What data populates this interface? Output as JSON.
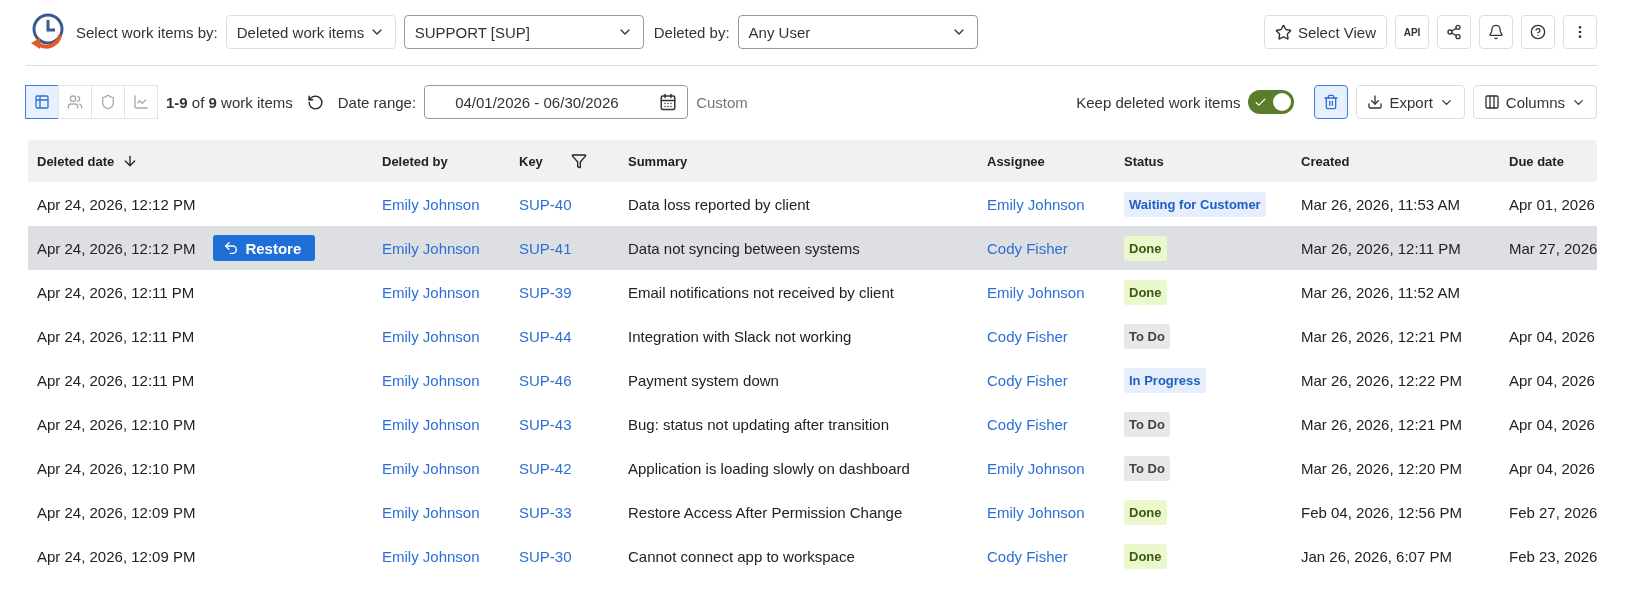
{
  "filter_bar": {
    "select_label": "Select work items by:",
    "mode": "Deleted work items",
    "project": "SUPPORT [SUP]",
    "deleted_by_label": "Deleted by:",
    "deleted_by": "Any User",
    "select_view": "Select View",
    "api": "API"
  },
  "toolbar": {
    "view_modes": [
      {
        "kind": "table",
        "selected": true
      },
      {
        "kind": "people",
        "selected": false
      },
      {
        "kind": "shield",
        "selected": false
      },
      {
        "kind": "chart",
        "selected": false
      }
    ],
    "count": "**1-9** of **9** work items",
    "date_label": "Date range:",
    "date_range": "04/01/2026 - 06/30/2026",
    "range_type": "Custom",
    "keep_label": "Keep deleted work items",
    "keep_on": true,
    "trash_selected": true,
    "export": "Export",
    "columns": "Columns"
  },
  "table": {
    "columns": [
      "Deleted date",
      "Deleted by",
      "Key",
      "Summary",
      "Assignee",
      "Status",
      "Created",
      "Due date"
    ],
    "rows": [
      {
        "deleted": "Apr 24, 2026, 12:12 PM",
        "by": "Emily Johnson",
        "key": "SUP-40",
        "summary": "Data loss reported by client",
        "assignee": "Emily Johnson",
        "status": {
          "label": "Waiting for Customer",
          "kind": "progress"
        },
        "created": "Mar 26, 2026, 11:53 AM",
        "due": "Apr 01, 2026",
        "highlighted": false
      },
      {
        "deleted": "Apr 24, 2026, 12:12 PM",
        "by": "Emily Johnson",
        "key": "SUP-41",
        "summary": "Data not syncing between systems",
        "assignee": "Cody Fisher",
        "status": {
          "label": "Done",
          "kind": "done"
        },
        "created": "Mar 26, 2026, 12:11 PM",
        "due": "Mar 27, 2026",
        "highlighted": true,
        "action": "Restore"
      },
      {
        "deleted": "Apr 24, 2026, 12:11 PM",
        "by": "Emily Johnson",
        "key": "SUP-39",
        "summary": "Email notifications not received by client",
        "assignee": "Emily Johnson",
        "status": {
          "label": "Done",
          "kind": "done"
        },
        "created": "Mar 26, 2026, 11:52 AM",
        "highlighted": false
      },
      {
        "deleted": "Apr 24, 2026, 12:11 PM",
        "by": "Emily Johnson",
        "key": "SUP-44",
        "summary": "Integration with Slack not working",
        "assignee": "Cody Fisher",
        "status": {
          "label": "To Do",
          "kind": "todo"
        },
        "created": "Mar 26, 2026, 12:21 PM",
        "due": "Apr 04, 2026",
        "highlighted": false
      },
      {
        "deleted": "Apr 24, 2026, 12:11 PM",
        "by": "Emily Johnson",
        "key": "SUP-46",
        "summary": "Payment system down",
        "assignee": "Cody Fisher",
        "status": {
          "label": "In Progress",
          "kind": "progress"
        },
        "created": "Mar 26, 2026, 12:22 PM",
        "due": "Apr 04, 2026",
        "highlighted": false
      },
      {
        "deleted": "Apr 24, 2026, 12:10 PM",
        "by": "Emily Johnson",
        "key": "SUP-43",
        "summary": "Bug: status not updating after transition",
        "assignee": "Cody Fisher",
        "status": {
          "label": "To Do",
          "kind": "todo"
        },
        "created": "Mar 26, 2026, 12:21 PM",
        "due": "Apr 04, 2026",
        "highlighted": false
      },
      {
        "deleted": "Apr 24, 2026, 12:10 PM",
        "by": "Emily Johnson",
        "key": "SUP-42",
        "summary": "Application is loading slowly on dashboard",
        "assignee": "Emily Johnson",
        "status": {
          "label": "To Do",
          "kind": "todo"
        },
        "created": "Mar 26, 2026, 12:20 PM",
        "due": "Apr 04, 2026",
        "highlighted": false
      },
      {
        "deleted": "Apr 24, 2026, 12:09 PM",
        "by": "Emily Johnson",
        "key": "SUP-33",
        "summary": "Restore Access After Permission Change",
        "assignee": "Emily Johnson",
        "status": {
          "label": "Done",
          "kind": "done"
        },
        "created": "Feb 04, 2026, 12:56 PM",
        "due": "Feb 27, 2026",
        "highlighted": false
      },
      {
        "deleted": "Apr 24, 2026, 12:09 PM",
        "by": "Emily Johnson",
        "key": "SUP-30",
        "summary": "Cannot connect app to workspace",
        "assignee": "Cody Fisher",
        "status": {
          "label": "Done",
          "kind": "done"
        },
        "created": "Jan 26, 2026, 6:07 PM",
        "due": "Feb 23, 2026",
        "highlighted": false
      }
    ]
  }
}
